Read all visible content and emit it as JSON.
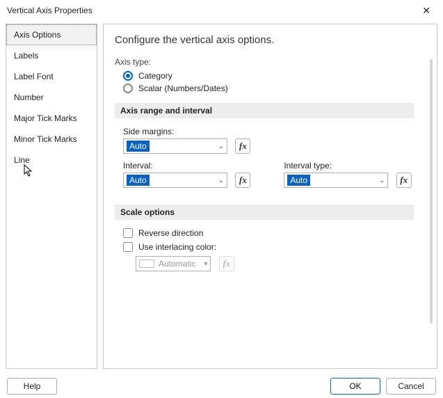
{
  "title": "Vertical Axis Properties",
  "nav": {
    "items": [
      {
        "label": "Axis Options"
      },
      {
        "label": "Labels"
      },
      {
        "label": "Label Font"
      },
      {
        "label": "Number"
      },
      {
        "label": "Major Tick Marks"
      },
      {
        "label": "Minor Tick Marks"
      },
      {
        "label": "Line"
      }
    ],
    "selected_index": 0
  },
  "heading": "Configure the vertical axis options.",
  "axis_type": {
    "label": "Axis type:",
    "options": [
      {
        "label": "Category",
        "checked": true
      },
      {
        "label": "Scalar (Numbers/Dates)",
        "checked": false
      }
    ]
  },
  "sections": {
    "range": "Axis range and interval",
    "scale": "Scale options"
  },
  "range": {
    "side_margins": {
      "label": "Side margins:",
      "value": "Auto"
    },
    "interval": {
      "label": "Interval:",
      "value": "Auto"
    },
    "interval_type": {
      "label": "Interval type:",
      "value": "Auto"
    }
  },
  "scale": {
    "reverse": {
      "label": "Reverse direction",
      "checked": false
    },
    "interlace": {
      "label": "Use interlacing color:",
      "checked": false
    },
    "color": {
      "label": "Automatic"
    }
  },
  "fx_label": "fx",
  "buttons": {
    "help": "Help",
    "ok": "OK",
    "cancel": "Cancel"
  }
}
